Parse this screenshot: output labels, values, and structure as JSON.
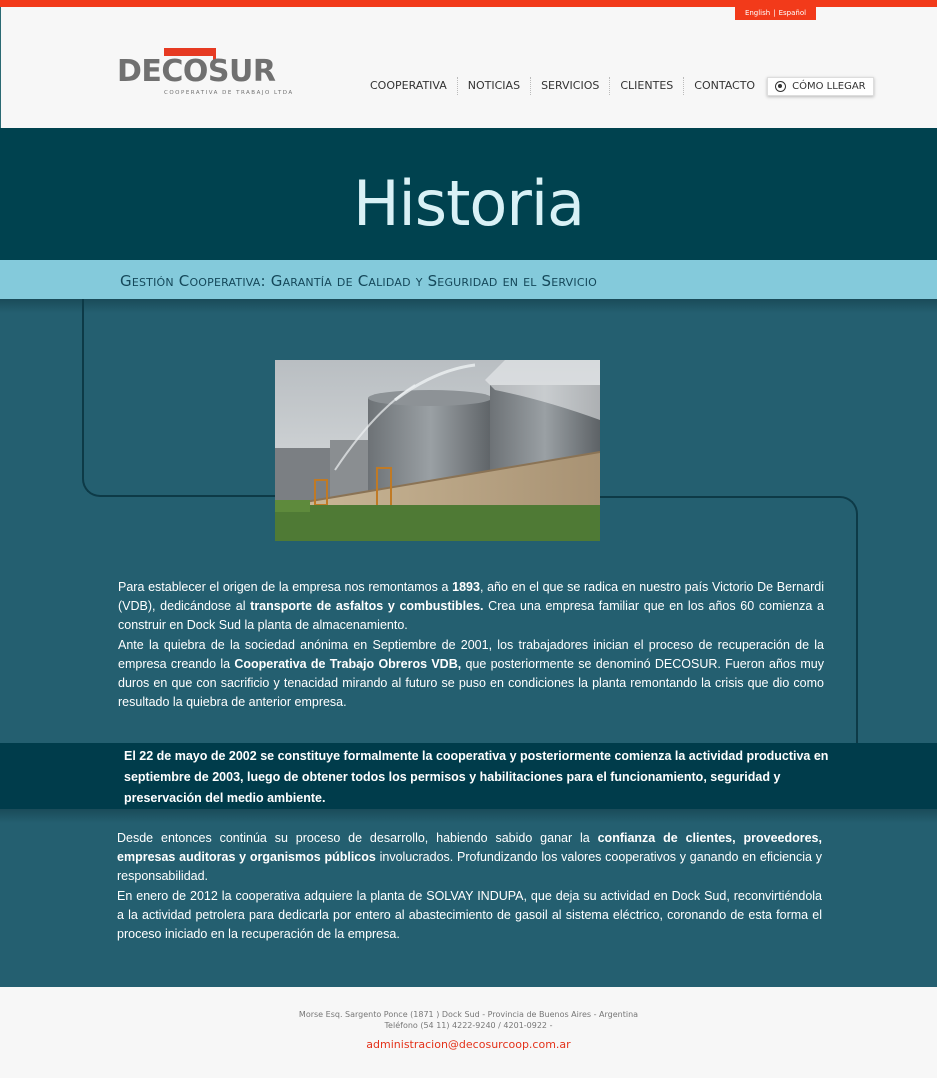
{
  "lang": {
    "english": "English",
    "separator": "|",
    "spanish": "Español"
  },
  "logo": {
    "word": "DECOSUR",
    "tagline": "COOPERATIVA DE TRABAJO LTDA"
  },
  "nav": {
    "items": [
      "COOPERATIVA",
      "NOTICIAS",
      "SERVICIOS",
      "CLIENTES",
      "CONTACTO"
    ],
    "llegar": {
      "label": "CÓMO LLEGAR",
      "icon": "globe-icon"
    }
  },
  "hero": {
    "title": "Historia"
  },
  "subtitle": "Gestión Cooperativa: Garantía de Calidad y Seguridad en el Servicio",
  "photo": {
    "icon": "fuel-tanks-photo"
  },
  "paragraph1": {
    "a": "Para establecer el origen de la empresa nos remontamos a ",
    "b": "1893",
    "c": ", año en el que se radica en nuestro país Victorio De Bernardi (VDB), dedicándose al ",
    "d": "transporte de asfaltos y combustibles.",
    "e": " Crea una empresa familiar que en los años 60 comienza a construir en Dock Sud la planta de almacenamiento."
  },
  "paragraph2": {
    "a": "Ante la quiebra de la sociedad anónima en Septiembre de 2001, los trabajadores inician el proceso de recuperación de la empresa creando la ",
    "b": "Cooperativa de Trabajo Obreros VDB,",
    "c": " que posteriormente se denominó DECOSUR. Fueron años muy duros en que con sacrificio y tenacidad mirando al futuro se puso en condiciones la planta remontando la crisis que dio como resultado la quiebra de anterior empresa."
  },
  "highlight": "El 22 de mayo de 2002 se constituye formalmente la cooperativa y posteriormente comienza la actividad productiva en septiembre de 2003, luego de obtener todos los permisos y habilitaciones para el funcionamiento, seguridad y preservación del medio ambiente.",
  "paragraph3": {
    "a": "Desde entonces continúa su proceso de desarrollo, habiendo sabido ganar la ",
    "b": "confianza de clientes, proveedores, empresas auditoras y organismos públicos",
    "c": " involucrados. Profundizando los valores cooperativos y ganando en eficiencia y responsabilidad."
  },
  "paragraph4": "En enero de 2012 la cooperativa adquiere la planta de SOLVAY INDUPA, que deja su actividad en Dock Sud, reconvirtiéndola a la actividad petrolera para dedicarla por entero al abastecimiento de gasoil al sistema eléctrico, coronando de esta forma el proceso iniciado en la recuperación de la empresa.",
  "footer": {
    "address": "Morse Esq. Sargento Ponce (1871 ) Dock Sud - Provincia de Buenos Aires - Argentina",
    "phone": "Teléfono (54 11) 4222-9240 / 4201-0922 -",
    "email": "administracion@decosurcoop.com.ar"
  },
  "colors": {
    "accent": "#f23a1a",
    "hero": "#00424f",
    "subtitle_bar": "#84cadb",
    "main": "#245f70",
    "band": "#003c4b"
  }
}
